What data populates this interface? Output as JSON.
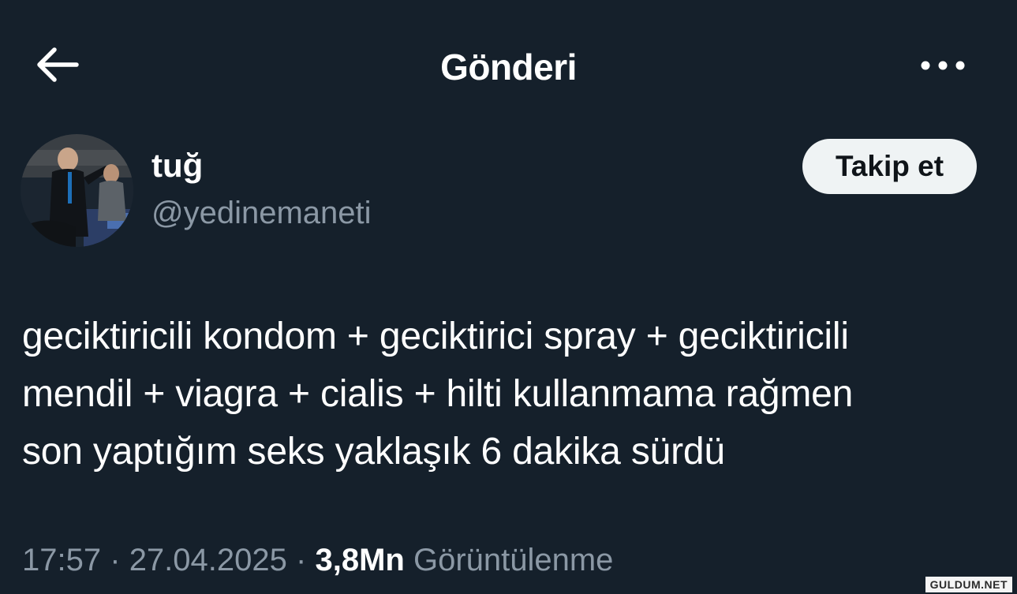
{
  "header": {
    "title": "Gönderi",
    "back_icon": "arrow-left-icon",
    "more_icon": "more-horizontal-icon"
  },
  "author": {
    "display_name": "tuğ",
    "handle": "@yedinemaneti",
    "follow_label": "Takip et"
  },
  "tweet": {
    "text_lines": [
      "geciktiricili kondom + geciktirici spray + geciktiricili",
      "mendil + viagra + cialis + hilti kullanmama rağmen",
      "son yaptığım seks yaklaşık 6 dakika sürdü"
    ]
  },
  "meta": {
    "time": "17:57",
    "separator": "·",
    "date": "27.04.2025",
    "views_count": "3,8Mn",
    "views_label": "Görüntülenme"
  },
  "watermark": "GULDUM.NET",
  "colors": {
    "background": "#15202b",
    "text_primary": "#ffffff",
    "text_secondary": "#8b98a5",
    "button_bg": "#eff3f4",
    "button_text": "#0f1419"
  }
}
